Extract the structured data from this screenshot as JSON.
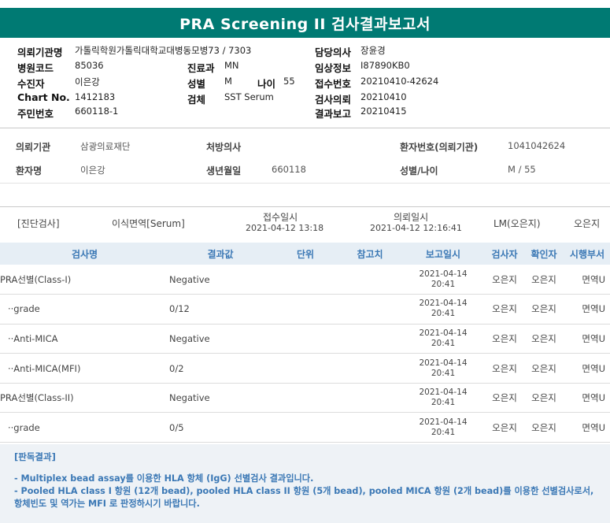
{
  "title": "PRA Screening II 검사결과보고서",
  "header": {
    "institution_label": "의뢰기관명",
    "institution": "가톨릭학원가톨릭대학교대병동모병73 / 7303",
    "doctor_label": "담당의사",
    "doctor": "장윤경",
    "hospital_code_label": "병원코드",
    "hospital_code": "85036",
    "dept_label": "진료과",
    "dept": "MN",
    "clinical_label": "임상정보",
    "clinical": "I87890KB0",
    "patient_label": "수진자",
    "patient": "이은강",
    "sex_label": "성별",
    "sex": "M",
    "age_label": "나이",
    "age": "55",
    "receipt_label": "접수번호",
    "receipt": "20210410-42624",
    "chart_label": "Chart No.",
    "chart": "1412183",
    "specimen_label": "검체",
    "specimen": "SST Serum",
    "req_date_label": "검사의뢰",
    "req_date": "20210410",
    "resident_label": "주민번호",
    "resident": "660118-1",
    "report_date_label": "결과보고",
    "report_date": "20210415"
  },
  "info": {
    "req_inst_label": "의뢰기관",
    "req_inst": "삼광의료재단",
    "prescriber_label": "처방의사",
    "prescriber": "",
    "pt_no_label": "환자번호(의뢰기관)",
    "pt_no": "1041042624",
    "pt_name_label": "환자명",
    "pt_name": "이은강",
    "birth_label": "생년월일",
    "birth": "660118",
    "sexage_label": "성별/나이",
    "sexage": "M / 55"
  },
  "order": {
    "category": "[진단검사]",
    "test": "이식면역[Serum]",
    "recv_label": "접수일시",
    "recv": "2021-04-12 13:18",
    "req_label": "의뢰일시",
    "req": "2021-04-12 12:16:41",
    "lm": "LM(오은지)",
    "user": "오은지"
  },
  "table": {
    "headers": [
      "검사명",
      "결과값",
      "단위",
      "참고치",
      "보고일시",
      "검사자",
      "확인자",
      "시행부서"
    ],
    "rows": [
      {
        "name": "PRA선별(Class-I)",
        "result": "Negative",
        "unit": "",
        "ref": "",
        "date": "2021-04-14",
        "time": "20:41",
        "tester": "오은지",
        "checker": "오은지",
        "dept": "면역U"
      },
      {
        "name": "··grade",
        "result": "0/12",
        "unit": "",
        "ref": "",
        "date": "2021-04-14",
        "time": "20:41",
        "tester": "오은지",
        "checker": "오은지",
        "dept": "면역U"
      },
      {
        "name": "··Anti-MICA",
        "result": "Negative",
        "unit": "",
        "ref": "",
        "date": "2021-04-14",
        "time": "20:41",
        "tester": "오은지",
        "checker": "오은지",
        "dept": "면역U"
      },
      {
        "name": "··Anti-MICA(MFI)",
        "result": "0/2",
        "unit": "",
        "ref": "",
        "date": "2021-04-14",
        "time": "20:41",
        "tester": "오은지",
        "checker": "오은지",
        "dept": "면역U"
      },
      {
        "name": "PRA선별(Class-II)",
        "result": "Negative",
        "unit": "",
        "ref": "",
        "date": "2021-04-14",
        "time": "20:41",
        "tester": "오은지",
        "checker": "오은지",
        "dept": "면역U"
      },
      {
        "name": "··grade",
        "result": "0/5",
        "unit": "",
        "ref": "",
        "date": "2021-04-14",
        "time": "20:41",
        "tester": "오은지",
        "checker": "오은지",
        "dept": "면역U"
      }
    ]
  },
  "judgement": {
    "title": "[판독결과]",
    "line1": "- Multiplex bead assay를 이용한 HLA 항체 (IgG) 선별검사 결과입니다.",
    "line2": "- Pooled HLA class I 항원 (12개 bead), pooled HLA class II 항원 (5개 bead), pooled MICA 항원 (2개 bead)를 이용한 선별검사로서, 항체빈도 및 역가는 MFI 로 판정하시기 바랍니다."
  }
}
